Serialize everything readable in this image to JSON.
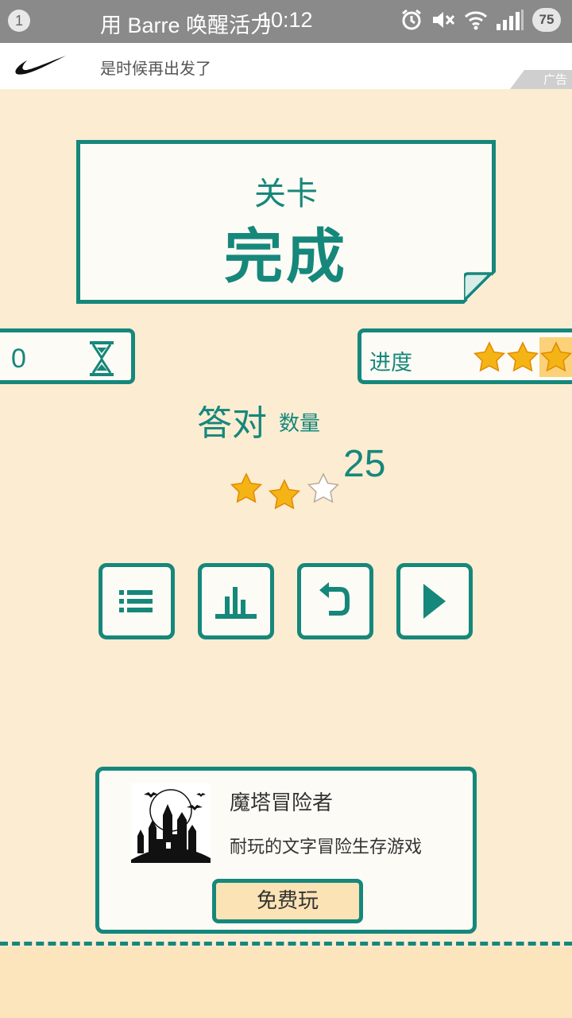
{
  "status_bar": {
    "notification_count": "1",
    "notification_title": "用 Barre 唤醒活力",
    "time": "10:12",
    "battery": "75",
    "icons": [
      "alarm-icon",
      "mute-icon",
      "wifi-icon",
      "signal-icon"
    ]
  },
  "ad_banner": {
    "subtitle": "是时候再出发了",
    "tag": "广告",
    "brand_icon": "nike-swoosh-icon"
  },
  "result": {
    "title_small": "关卡",
    "title_large": "完成"
  },
  "timer": {
    "value": "0",
    "icon": "hourglass-icon"
  },
  "progress": {
    "label": "进度",
    "stars_filled": 3,
    "stars_total": 3
  },
  "answers": {
    "label": "答对",
    "sublabel": "数量",
    "count": "25",
    "stars_filled": 2,
    "stars_total": 3
  },
  "actions": [
    {
      "name": "level-list-button",
      "icon": "list-icon"
    },
    {
      "name": "leaderboard-button",
      "icon": "bar-chart-icon"
    },
    {
      "name": "retry-button",
      "icon": "undo-icon"
    },
    {
      "name": "next-level-button",
      "icon": "play-icon"
    }
  ],
  "promo": {
    "title": "魔塔冒险者",
    "description": "耐玩的文字冒险生存游戏",
    "button_label": "免费玩",
    "thumbnail_icon": "haunted-castle-icon"
  },
  "colors": {
    "accent": "#16877b",
    "background": "#fbecd2",
    "card": "#fdfbf5",
    "star": "#f5b416",
    "highlight": "#fbd27a"
  }
}
